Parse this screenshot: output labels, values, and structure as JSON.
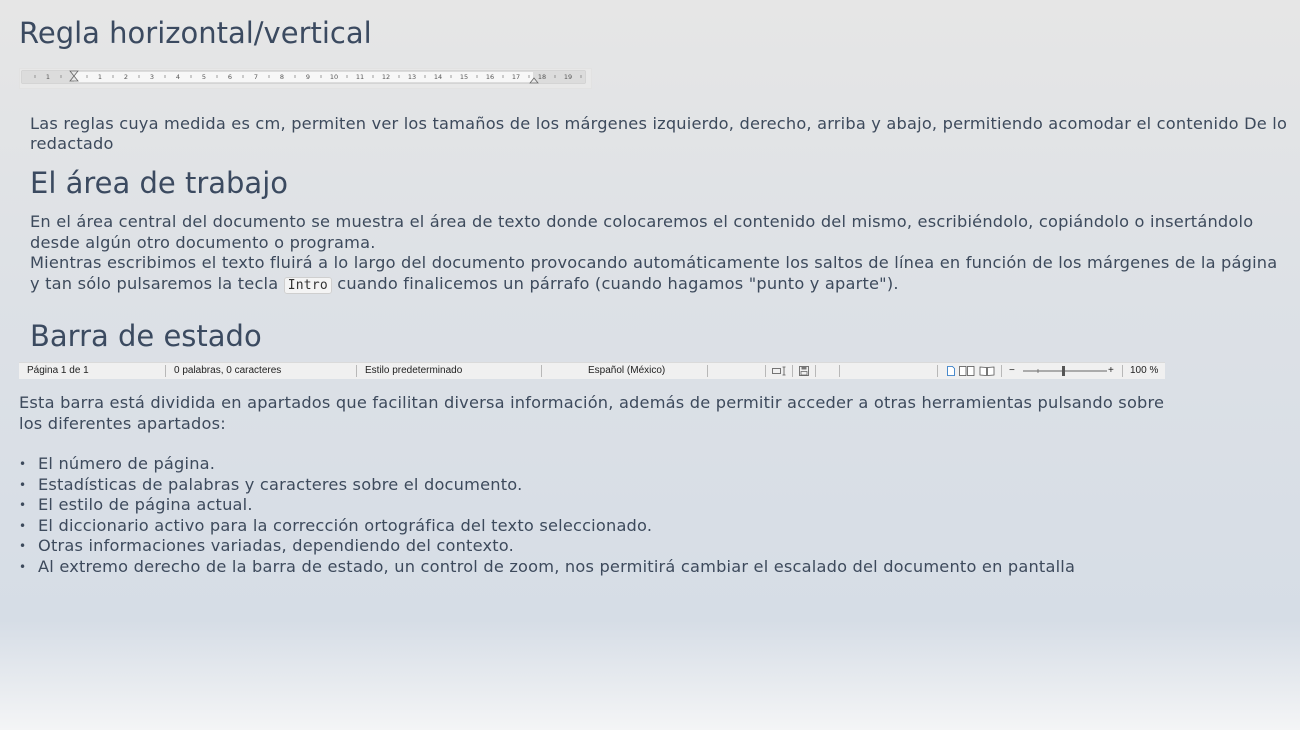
{
  "ruler_section": {
    "title": "Regla horizontal/vertical",
    "ruler_numbers": [
      "1",
      "1",
      "2",
      "3",
      "4",
      "5",
      "6",
      "7",
      "8",
      "9",
      "10",
      "11",
      "12",
      "13",
      "14",
      "15",
      "16",
      "17",
      "18",
      "19"
    ],
    "paragraph": "Las reglas cuya medida es cm, permiten ver los tamaños de los márgenes izquierdo, derecho, arriba y abajo, permitiendo acomodar el contenido De lo redactado"
  },
  "work_area": {
    "title": "El área de trabajo",
    "paragraph1": "En el área central del documento se muestra el área de texto donde colocaremos el contenido del mismo, escribiéndolo, copiándolo o insertándolo desde algún otro documento o programa.",
    "paragraph2_before": "Mientras escribimos el texto fluirá a lo largo del documento provocando automáticamente los saltos de línea en función de los márgenes de la página y tan sólo pulsaremos la tecla",
    "key": "Intro",
    "paragraph2_after": "cuando finalicemos un párrafo (cuando hagamos \"punto y aparte\")."
  },
  "status_section": {
    "title": "Barra de estado",
    "statusbar": {
      "page": "Página 1 de 1",
      "words": "0 palabras, 0 caracteres",
      "style": "Estilo predeterminado",
      "language": "Español (México)",
      "zoom": "100 %",
      "zoom_level": 0.5
    },
    "paragraph": "Esta barra está dividida en apartados que facilitan diversa información, además de permitir acceder a otras herramientas pulsando sobre los diferentes apartados:",
    "bullets": [
      "El número de página.",
      "Estadísticas de palabras y caracteres sobre el documento.",
      "El estilo de página actual.",
      "El diccionario activo para la corrección ortográfica del texto seleccionado.",
      "Otras informaciones variadas, dependiendo del contexto.",
      "Al extremo derecho de la barra de estado, un control de zoom, nos permitirá cambiar el escalado del documento en pantalla"
    ]
  }
}
